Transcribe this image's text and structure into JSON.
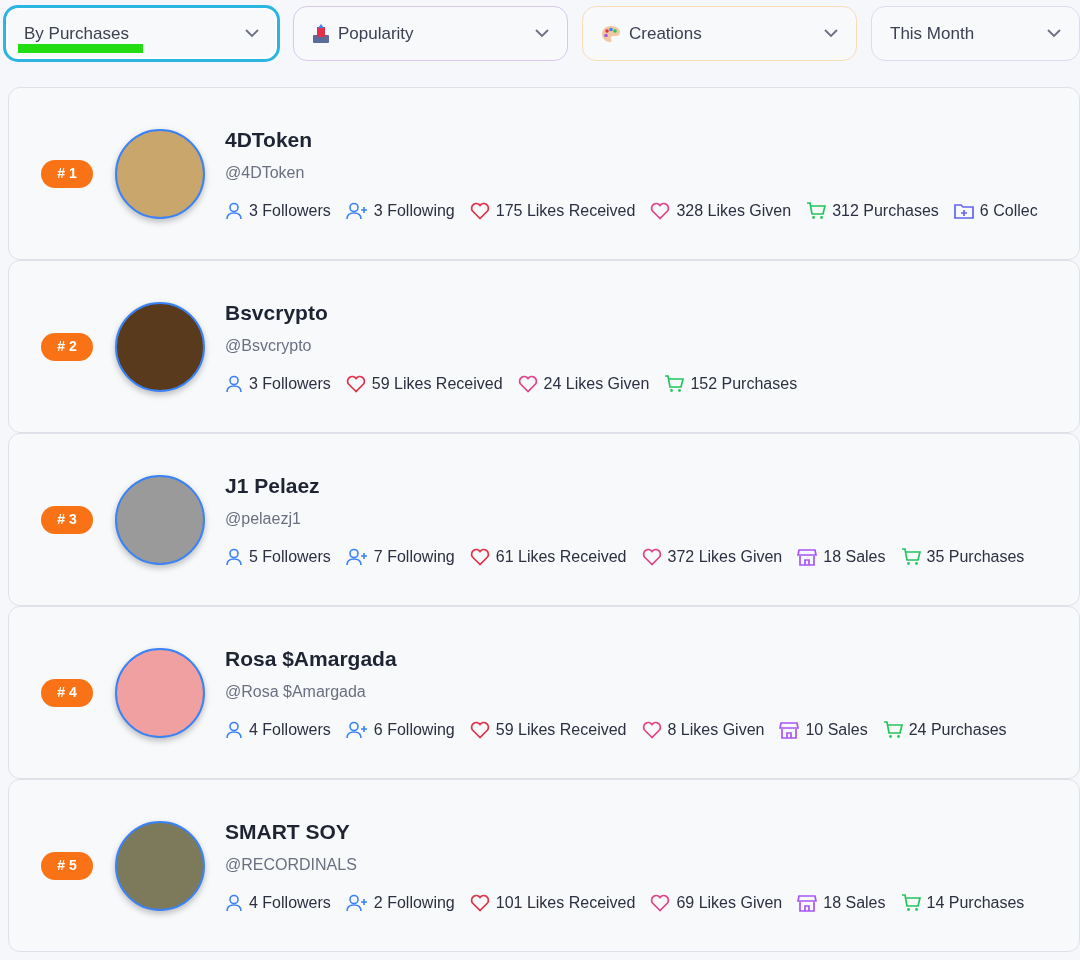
{
  "filters": [
    {
      "label": "By Purchases",
      "selected": true,
      "highlighted": true
    },
    {
      "label": "Popularity",
      "selected": false,
      "highlighted": false
    },
    {
      "label": "Creations",
      "selected": false,
      "highlighted": false
    },
    {
      "label": "This Month",
      "selected": false,
      "highlighted": false
    }
  ],
  "users": [
    {
      "rank": "# 1",
      "name": "4DToken",
      "handle": "@4DToken",
      "stats": [
        {
          "kind": "followers",
          "text": "3 Followers"
        },
        {
          "kind": "following",
          "text": "3 Following"
        },
        {
          "kind": "likes_received",
          "text": "175 Likes Received"
        },
        {
          "kind": "likes_given",
          "text": "328 Likes Given"
        },
        {
          "kind": "purchases",
          "text": "312 Purchases"
        },
        {
          "kind": "collections",
          "text": "6 Collec"
        }
      ]
    },
    {
      "rank": "# 2",
      "name": "Bsvcrypto",
      "handle": "@Bsvcrypto",
      "stats": [
        {
          "kind": "followers",
          "text": "3 Followers"
        },
        {
          "kind": "likes_received",
          "text": "59 Likes Received"
        },
        {
          "kind": "likes_given",
          "text": "24 Likes Given"
        },
        {
          "kind": "purchases",
          "text": "152 Purchases"
        }
      ]
    },
    {
      "rank": "# 3",
      "name": "J1 Pelaez",
      "handle": "@pelaezj1",
      "stats": [
        {
          "kind": "followers",
          "text": "5 Followers"
        },
        {
          "kind": "following",
          "text": "7 Following"
        },
        {
          "kind": "likes_received",
          "text": "61 Likes Received"
        },
        {
          "kind": "likes_given",
          "text": "372 Likes Given"
        },
        {
          "kind": "sales",
          "text": "18 Sales"
        },
        {
          "kind": "purchases",
          "text": "35 Purchases"
        }
      ]
    },
    {
      "rank": "# 4",
      "name": "Rosa $Amargada",
      "handle": "@Rosa $Amargada",
      "stats": [
        {
          "kind": "followers",
          "text": "4 Followers"
        },
        {
          "kind": "following",
          "text": "6 Following"
        },
        {
          "kind": "likes_received",
          "text": "59 Likes Received"
        },
        {
          "kind": "likes_given",
          "text": "8 Likes Given"
        },
        {
          "kind": "sales",
          "text": "10 Sales"
        },
        {
          "kind": "purchases",
          "text": "24 Purchases"
        }
      ]
    },
    {
      "rank": "# 5",
      "name": "SMART SOY",
      "handle": "@RECORDINALS",
      "stats": [
        {
          "kind": "followers",
          "text": "4 Followers"
        },
        {
          "kind": "following",
          "text": "2 Following"
        },
        {
          "kind": "likes_received",
          "text": "101 Likes Received"
        },
        {
          "kind": "likes_given",
          "text": "69 Likes Given"
        },
        {
          "kind": "sales",
          "text": "18 Sales"
        },
        {
          "kind": "purchases",
          "text": "14 Purchases"
        }
      ]
    }
  ]
}
